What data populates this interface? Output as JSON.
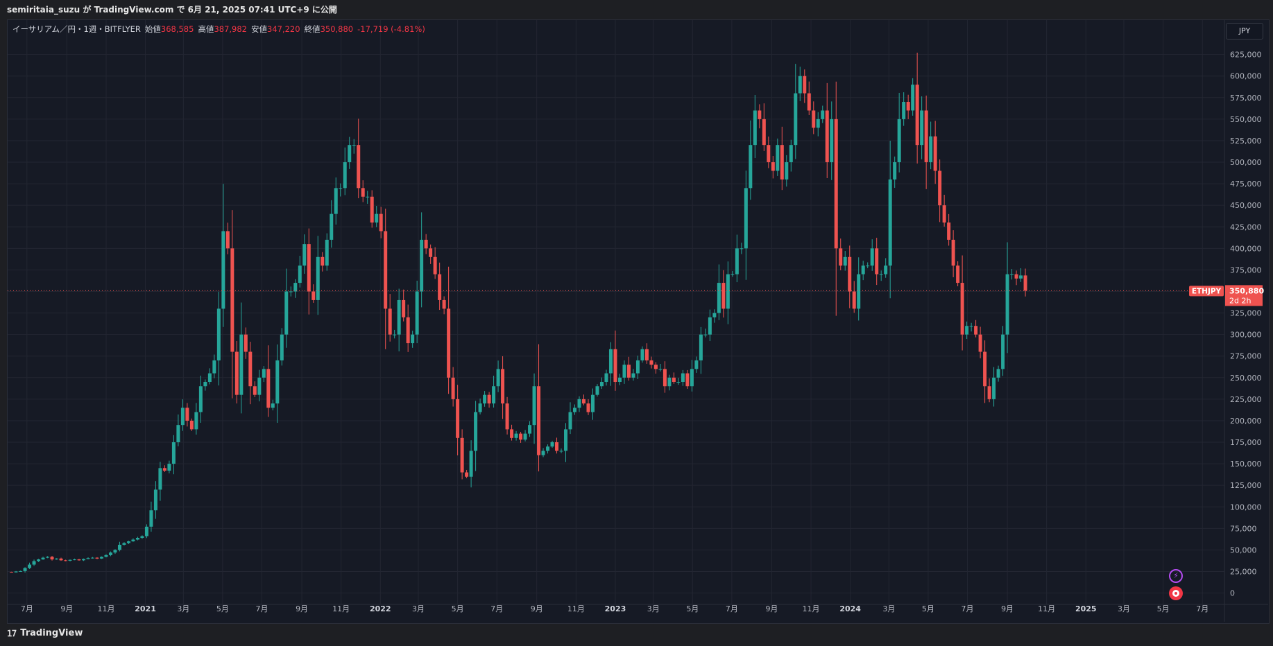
{
  "header": {
    "published": "semiritaia_suzu が TradingView.com で 6月 21, 2025 07:41 UTC+9 に公開"
  },
  "legend": {
    "symbol": "イーサリアム／円・1週・BITFLYER",
    "open_label": "始値",
    "open": "368,585",
    "high_label": "高値",
    "high": "387,982",
    "low_label": "安値",
    "low": "347,220",
    "close_label": "終値",
    "close": "350,880",
    "change": "-17,719 (-4.81%)"
  },
  "currency_button": "JPY",
  "last_price": {
    "ticker": "ETHJPY",
    "value": "350,880",
    "countdown": "2d 2h"
  },
  "footer": {
    "brand": "TradingView"
  },
  "colors": {
    "up": "#26a69a",
    "down": "#ef5350",
    "background": "#161a25",
    "grid": "#232632",
    "axis_text": "#b2b5be",
    "price_line": "#ef5350"
  },
  "chart_data": {
    "type": "candlestick",
    "title": "イーサリアム／円・1週・BITFLYER",
    "y_ticks": [
      0,
      25000,
      50000,
      75000,
      100000,
      125000,
      150000,
      175000,
      200000,
      225000,
      250000,
      275000,
      300000,
      325000,
      350000,
      375000,
      400000,
      425000,
      450000,
      475000,
      500000,
      525000,
      550000,
      575000,
      600000,
      625000
    ],
    "y_tick_labels": [
      "0",
      "25,000",
      "50,000",
      "75,000",
      "100,000",
      "125,000",
      "150,000",
      "175,000",
      "200,000",
      "225,000",
      "250,000",
      "275,000",
      "300,000",
      "325,000",
      "350,000",
      "375,000",
      "400,000",
      "425,000",
      "450,000",
      "475,000",
      "500,000",
      "525,000",
      "550,000",
      "575,000",
      "600,000",
      "625,000"
    ],
    "ylim": [
      -10000,
      640000
    ],
    "x_ticks": [
      {
        "label": "7月",
        "date": "2020-07-01",
        "bold": false
      },
      {
        "label": "9月",
        "date": "2020-09-01",
        "bold": false
      },
      {
        "label": "11月",
        "date": "2020-11-01",
        "bold": false
      },
      {
        "label": "2021",
        "date": "2021-01-01",
        "bold": true
      },
      {
        "label": "3月",
        "date": "2021-03-01",
        "bold": false
      },
      {
        "label": "5月",
        "date": "2021-05-01",
        "bold": false
      },
      {
        "label": "7月",
        "date": "2021-07-01",
        "bold": false
      },
      {
        "label": "9月",
        "date": "2021-09-01",
        "bold": false
      },
      {
        "label": "11月",
        "date": "2021-11-01",
        "bold": false
      },
      {
        "label": "2022",
        "date": "2022-01-01",
        "bold": true
      },
      {
        "label": "3月",
        "date": "2022-03-01",
        "bold": false
      },
      {
        "label": "5月",
        "date": "2022-05-01",
        "bold": false
      },
      {
        "label": "7月",
        "date": "2022-07-01",
        "bold": false
      },
      {
        "label": "9月",
        "date": "2022-09-01",
        "bold": false
      },
      {
        "label": "11月",
        "date": "2022-11-01",
        "bold": false
      },
      {
        "label": "2023",
        "date": "2023-01-01",
        "bold": true
      },
      {
        "label": "3月",
        "date": "2023-03-01",
        "bold": false
      },
      {
        "label": "5月",
        "date": "2023-05-01",
        "bold": false
      },
      {
        "label": "7月",
        "date": "2023-07-01",
        "bold": false
      },
      {
        "label": "9月",
        "date": "2023-09-01",
        "bold": false
      },
      {
        "label": "11月",
        "date": "2023-11-01",
        "bold": false
      },
      {
        "label": "2024",
        "date": "2024-01-01",
        "bold": true
      },
      {
        "label": "3月",
        "date": "2024-03-01",
        "bold": false
      },
      {
        "label": "5月",
        "date": "2024-05-01",
        "bold": false
      },
      {
        "label": "7月",
        "date": "2024-07-01",
        "bold": false
      },
      {
        "label": "9月",
        "date": "2024-09-01",
        "bold": false
      },
      {
        "label": "11月",
        "date": "2024-11-01",
        "bold": false
      },
      {
        "label": "2025",
        "date": "2025-01-01",
        "bold": true
      },
      {
        "label": "3月",
        "date": "2025-03-01",
        "bold": false
      },
      {
        "label": "5月",
        "date": "2025-05-01",
        "bold": false
      },
      {
        "label": "7月",
        "date": "2025-07-01",
        "bold": false
      }
    ],
    "xlim": [
      "2020-06-01",
      "2025-08-01"
    ],
    "grid": true,
    "last_price": 350880,
    "weekly_close": [
      24000,
      25000,
      25500,
      29000,
      33000,
      37000,
      39000,
      41000,
      42000,
      39000,
      40000,
      38000,
      37500,
      38500,
      39000,
      38000,
      39500,
      40500,
      41000,
      40000,
      42000,
      44000,
      47000,
      50000,
      56000,
      58000,
      60000,
      62000,
      64000,
      66000,
      77000,
      96000,
      120000,
      145000,
      142000,
      150000,
      175000,
      195000,
      215000,
      200000,
      190000,
      210000,
      240000,
      245000,
      255000,
      270000,
      330000,
      420000,
      400000,
      280000,
      230000,
      300000,
      280000,
      240000,
      230000,
      250000,
      260000,
      215000,
      220000,
      270000,
      300000,
      350000,
      350000,
      360000,
      380000,
      405000,
      350000,
      340000,
      390000,
      380000,
      410000,
      440000,
      470000,
      470000,
      500000,
      520000,
      520000,
      470000,
      460000,
      460000,
      430000,
      440000,
      420000,
      330000,
      300000,
      300000,
      340000,
      320000,
      290000,
      300000,
      350000,
      410000,
      400000,
      390000,
      370000,
      340000,
      330000,
      250000,
      225000,
      180000,
      140000,
      135000,
      165000,
      210000,
      220000,
      230000,
      220000,
      240000,
      260000,
      220000,
      190000,
      180000,
      185000,
      178000,
      185000,
      195000,
      240000,
      160000,
      165000,
      170000,
      175000,
      165000,
      165000,
      190000,
      210000,
      215000,
      225000,
      220000,
      210000,
      230000,
      240000,
      245000,
      255000,
      283000,
      245000,
      250000,
      265000,
      250000,
      255000,
      270000,
      283000,
      270000,
      265000,
      260000,
      260000,
      240000,
      250000,
      245000,
      245000,
      255000,
      240000,
      260000,
      270000,
      300000,
      300000,
      320000,
      325000,
      360000,
      330000,
      370000,
      370000,
      400000,
      400000,
      470000,
      520000,
      560000,
      550000,
      520000,
      500000,
      490000,
      520000,
      480000,
      500000,
      520000,
      580000,
      600000,
      580000,
      560000,
      540000,
      550000,
      560000,
      500000,
      550000,
      400000,
      380000,
      390000,
      350000,
      330000,
      370000,
      380000,
      380000,
      400000,
      370000,
      370000,
      380000,
      480000,
      500000,
      550000,
      570000,
      560000,
      590000,
      520000,
      560000,
      500000,
      530000,
      490000,
      450000,
      430000,
      410000,
      380000,
      360000,
      300000,
      310000,
      310000,
      300000,
      280000,
      240000,
      225000,
      250000,
      260000,
      300000,
      370000,
      370000,
      365000,
      368585,
      350880
    ],
    "weekly_open_first": 24500,
    "scale_note": "bitFlyer ETH/JPY weekly candles"
  }
}
